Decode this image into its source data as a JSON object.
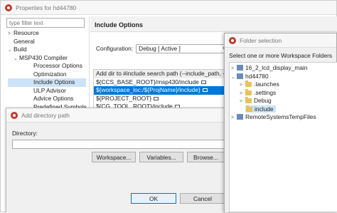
{
  "properties": {
    "title": "Properties for hd44780",
    "filter_placeholder": "type filter text",
    "tree": [
      "Resource",
      "General",
      "Build",
      "MSP430 Compiler",
      "Processor Options",
      "Optimization",
      "Include Options",
      "ULP Advisor",
      "Advice Options",
      "Predefined Symbols"
    ],
    "page_title": "Include Options",
    "config_label": "Configuration:",
    "config_value": "Debug  [ Active ]",
    "paths_header": "Add dir to #include search path (--include_path, -I)",
    "paths": [
      "${CCS_BASE_ROOT}/msp430/include",
      "${workspace_loc:/${ProjName}/include}",
      "${PROJECT_ROOT}",
      "${CG_TOOL_ROOT}/include"
    ]
  },
  "add_dir": {
    "title": "Add directory path",
    "directory_label": "Directory:",
    "directory_value": "",
    "buttons": [
      "Workspace...",
      "Variables...",
      "Browse..."
    ],
    "ok": "OK",
    "cancel": "Cancel"
  },
  "folder_selection": {
    "title": "Folder selection",
    "prompt": "Select one or more Workspace Folders",
    "tree": [
      "16_2_lcd_display_main",
      "hd44780",
      ".launches",
      ".settings",
      "Debug",
      "include",
      "RemoteSystemsTempFiles"
    ]
  },
  "colors": {
    "selection": "#cde3f7",
    "selection_strong": "#0078d7",
    "icon_red": "#c0392b"
  }
}
